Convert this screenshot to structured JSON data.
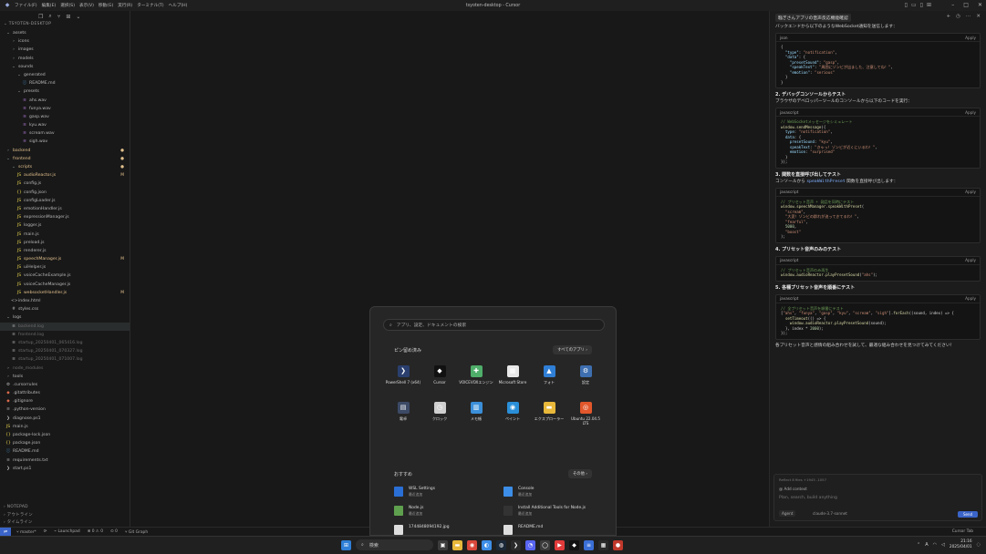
{
  "titlebar": {
    "title": "tsyoten-desktop - Cursor",
    "menus": [
      "ファイル(F)",
      "編集(E)",
      "選択(S)",
      "表示(V)",
      "移動(G)",
      "実行(R)",
      "ターミナル(T)",
      "ヘルプ(H)"
    ]
  },
  "explorer": {
    "section_title": "TSYOTEN-DESKTOP",
    "rows": [
      {
        "label": "assets",
        "depth": 0,
        "icon": "chevron-down",
        "kind": "folder"
      },
      {
        "label": "icons",
        "depth": 1,
        "icon": "chevron-right",
        "kind": "folder"
      },
      {
        "label": "images",
        "depth": 1,
        "icon": "chevron-right",
        "kind": "folder"
      },
      {
        "label": "models",
        "depth": 1,
        "icon": "chevron-right",
        "kind": "folder"
      },
      {
        "label": "sounds",
        "depth": 1,
        "icon": "chevron-down",
        "kind": "folder"
      },
      {
        "label": "generated",
        "depth": 2,
        "icon": "chevron-down",
        "kind": "folder"
      },
      {
        "label": "README.md",
        "depth": 3,
        "icon": "info",
        "kind": "md"
      },
      {
        "label": "presets",
        "depth": 2,
        "icon": "chevron-down",
        "kind": "folder"
      },
      {
        "label": "ahs.wav",
        "depth": 3,
        "icon": "wave",
        "kind": "wav"
      },
      {
        "label": "funya.wav",
        "depth": 3,
        "icon": "wave",
        "kind": "wav"
      },
      {
        "label": "gasp.wav",
        "depth": 3,
        "icon": "wave",
        "kind": "wav"
      },
      {
        "label": "kyu.wav",
        "depth": 3,
        "icon": "wave",
        "kind": "wav"
      },
      {
        "label": "scream.wav",
        "depth": 3,
        "icon": "wave",
        "kind": "wav"
      },
      {
        "label": "sigh.wav",
        "depth": 3,
        "icon": "wave",
        "kind": "wav"
      },
      {
        "label": "backend",
        "depth": 0,
        "icon": "chevron-right",
        "kind": "folder",
        "status": "mod-dot"
      },
      {
        "label": "frontend",
        "depth": 0,
        "icon": "chevron-down",
        "kind": "folder",
        "status": "mod-dot"
      },
      {
        "label": "scripts",
        "depth": 1,
        "icon": "chevron-down",
        "kind": "folder",
        "status": "mod-dot"
      },
      {
        "label": "audioReactor.js",
        "depth": 2,
        "icon": "js",
        "kind": "js",
        "status": "M"
      },
      {
        "label": "config.js",
        "depth": 2,
        "icon": "js",
        "kind": "js"
      },
      {
        "label": "config.json",
        "depth": 2,
        "icon": "json",
        "kind": "json"
      },
      {
        "label": "configLoader.js",
        "depth": 2,
        "icon": "js",
        "kind": "js"
      },
      {
        "label": "emotionHandler.js",
        "depth": 2,
        "icon": "js",
        "kind": "js"
      },
      {
        "label": "expressionManager.js",
        "depth": 2,
        "icon": "js",
        "kind": "js"
      },
      {
        "label": "logger.js",
        "depth": 2,
        "icon": "js",
        "kind": "js"
      },
      {
        "label": "main.js",
        "depth": 2,
        "icon": "js",
        "kind": "js"
      },
      {
        "label": "preload.js",
        "depth": 2,
        "icon": "js",
        "kind": "js"
      },
      {
        "label": "renderer.js",
        "depth": 2,
        "icon": "js",
        "kind": "js"
      },
      {
        "label": "speechManager.js",
        "depth": 2,
        "icon": "js",
        "kind": "js",
        "status": "M"
      },
      {
        "label": "uiHelper.js",
        "depth": 2,
        "icon": "js",
        "kind": "js"
      },
      {
        "label": "voiceCacheExample.js",
        "depth": 2,
        "icon": "js",
        "kind": "js"
      },
      {
        "label": "voiceCacheManager.js",
        "depth": 2,
        "icon": "js",
        "kind": "js"
      },
      {
        "label": "websocketHandler.js",
        "depth": 2,
        "icon": "js",
        "kind": "js",
        "status": "M"
      },
      {
        "label": "index.html",
        "depth": 1,
        "icon": "html",
        "kind": "html"
      },
      {
        "label": "styles.css",
        "depth": 1,
        "icon": "css",
        "kind": "css"
      },
      {
        "label": "logs",
        "depth": 0,
        "icon": "chevron-down",
        "kind": "folder"
      },
      {
        "label": "backend.log",
        "depth": 1,
        "icon": "log",
        "kind": "dim",
        "selected": true
      },
      {
        "label": "frontend.log",
        "depth": 1,
        "icon": "log",
        "kind": "dim"
      },
      {
        "label": "startup_20250401_065416.log",
        "depth": 1,
        "icon": "log",
        "kind": "dim"
      },
      {
        "label": "startup_20250401_070327.log",
        "depth": 1,
        "icon": "log",
        "kind": "dim"
      },
      {
        "label": "startup_20250401_071007.log",
        "depth": 1,
        "icon": "log",
        "kind": "dim"
      },
      {
        "label": "node_modules",
        "depth": 0,
        "icon": "chevron-right",
        "kind": "dim"
      },
      {
        "label": "tools",
        "depth": 0,
        "icon": "chevron-right",
        "kind": "folder"
      },
      {
        "label": ".cursorrules",
        "depth": 0,
        "icon": "gear",
        "kind": "plain"
      },
      {
        "label": ".gitattributes",
        "depth": 0,
        "icon": "git",
        "kind": "git"
      },
      {
        "label": ".gitignore",
        "depth": 0,
        "icon": "git",
        "kind": "git"
      },
      {
        "label": ".python-version",
        "depth": 0,
        "icon": "file",
        "kind": "plain"
      },
      {
        "label": "diagnose.ps1",
        "depth": 0,
        "icon": "ps",
        "kind": "plain"
      },
      {
        "label": "main.js",
        "depth": 0,
        "icon": "js",
        "kind": "js"
      },
      {
        "label": "package-lock.json",
        "depth": 0,
        "icon": "json",
        "kind": "json"
      },
      {
        "label": "package.json",
        "depth": 0,
        "icon": "json",
        "kind": "json"
      },
      {
        "label": "README.md",
        "depth": 0,
        "icon": "info",
        "kind": "md"
      },
      {
        "label": "requirements.txt",
        "depth": 0,
        "icon": "file",
        "kind": "plain"
      },
      {
        "label": "start.ps1",
        "depth": 0,
        "icon": "ps",
        "kind": "plain"
      }
    ],
    "bottom_sections": [
      "アウトライン",
      "タイムライン"
    ],
    "bottom_header": "NOTEPAD"
  },
  "chat": {
    "tab_title": "騒ぎさんアプリの音声反応機能確認",
    "intro": "バックエンドから以下のようなWebSocket通知を送信します：",
    "block1": {
      "lang": "json",
      "apply": "Apply"
    },
    "h2": "2. デバッグコンソールからテスト",
    "p2": "ブラウザのデベロッパーツールのコンソールから以下のコードを実行：",
    "block2": {
      "lang": "javascript",
      "apply": "Apply"
    },
    "h3": "3. 関数を直接呼び出してテスト",
    "p3_pre": "コンソールから ",
    "p3_code": "speakWithPreset",
    "p3_post": " 関数を直接呼び出します：",
    "block3": {
      "lang": "javascript",
      "apply": "Apply"
    },
    "h4": "4. プリセット音声のみのテスト",
    "block4": {
      "lang": "javascript",
      "apply": "Apply"
    },
    "h5": "5. 各種プリセット音声を順番にテスト",
    "block5": {
      "lang": "javascript",
      "apply": "Apply"
    },
    "closing": "各プリセット音声と感情の組み合わせを試して、最適な組み合わせを見つけてみてください！",
    "composer": {
      "meta": "Reflect 8 files  +1945  -1057",
      "context": "Add context",
      "placeholder": "Plan, search, build anything",
      "agent": "Agent",
      "model": "claude-3.7-sonnet",
      "send": "Send"
    }
  },
  "statusbar": {
    "branch": "master*",
    "live": "Launchpad",
    "errors": "⊗ 0 ⚠ 0",
    "ports": "0",
    "graph": "Git Graph",
    "right": "Cursor Tab"
  },
  "startmenu": {
    "search_placeholder": "アプリ、設定、ドキュメントの検索",
    "pinned_title": "ピン留め済み",
    "all_apps": "すべてのアプリ",
    "apps": [
      {
        "label": "PowerShell 7 (x64)",
        "icon": "powershell-icon",
        "color": "#2a3f6e",
        "glyph": "❯"
      },
      {
        "label": "Cursor",
        "icon": "cursor-icon",
        "color": "#111111",
        "glyph": "◆"
      },
      {
        "label": "VOICEVOXエンジン",
        "icon": "voicevox-icon",
        "color": "#4fae6a",
        "glyph": "✚"
      },
      {
        "label": "Microsoft Store",
        "icon": "store-icon",
        "color": "#e8e8e8",
        "glyph": "▦"
      },
      {
        "label": "フォト",
        "icon": "photos-icon",
        "color": "#2f7fd6",
        "glyph": "▲"
      },
      {
        "label": "設定",
        "icon": "settings-icon",
        "color": "#3e6fb0",
        "glyph": "⚙"
      },
      {
        "label": "電卓",
        "icon": "calculator-icon",
        "color": "#3c4a66",
        "glyph": "▤"
      },
      {
        "label": "クロック",
        "icon": "clock-icon",
        "color": "#cfcfcf",
        "glyph": "◷"
      },
      {
        "label": "メモ帳",
        "icon": "notepad-icon",
        "color": "#3b8fd9",
        "glyph": "▥"
      },
      {
        "label": "ペイント",
        "icon": "paint-icon",
        "color": "#2a8fd8",
        "glyph": "◉"
      },
      {
        "label": "エクスプローラー",
        "icon": "folder-icon",
        "color": "#e8b83a",
        "glyph": "▬"
      },
      {
        "label": "Ubuntu 22.04.5 LTS",
        "icon": "ubuntu-icon",
        "color": "#e2572b",
        "glyph": "◎"
      }
    ],
    "rec_title": "おすすめ",
    "more": "その他",
    "recommended": [
      {
        "name": "WSL Settings",
        "sub": "最近追加",
        "icon": "wsl-icon",
        "color": "#2a6fd6"
      },
      {
        "name": "Console",
        "sub": "最近追加",
        "icon": "console-icon",
        "color": "#3d8ee8"
      },
      {
        "name": "Node.js",
        "sub": "最近追加",
        "icon": "nodejs-icon",
        "color": "#5fa04e"
      },
      {
        "name": "Install Additional Tools for Node.js",
        "sub": "最近追加",
        "icon": "terminal-icon",
        "color": "#333333"
      },
      {
        "name": "1744848094192.jpg",
        "sub": "",
        "icon": "image-file-icon",
        "color": "#dddddd"
      },
      {
        "name": "README.md",
        "sub": "",
        "icon": "doc-file-icon",
        "color": "#dddddd"
      }
    ]
  },
  "taskbar": {
    "search": "検索",
    "time": "21:16",
    "date": "2025/04/01",
    "lang": "A"
  }
}
